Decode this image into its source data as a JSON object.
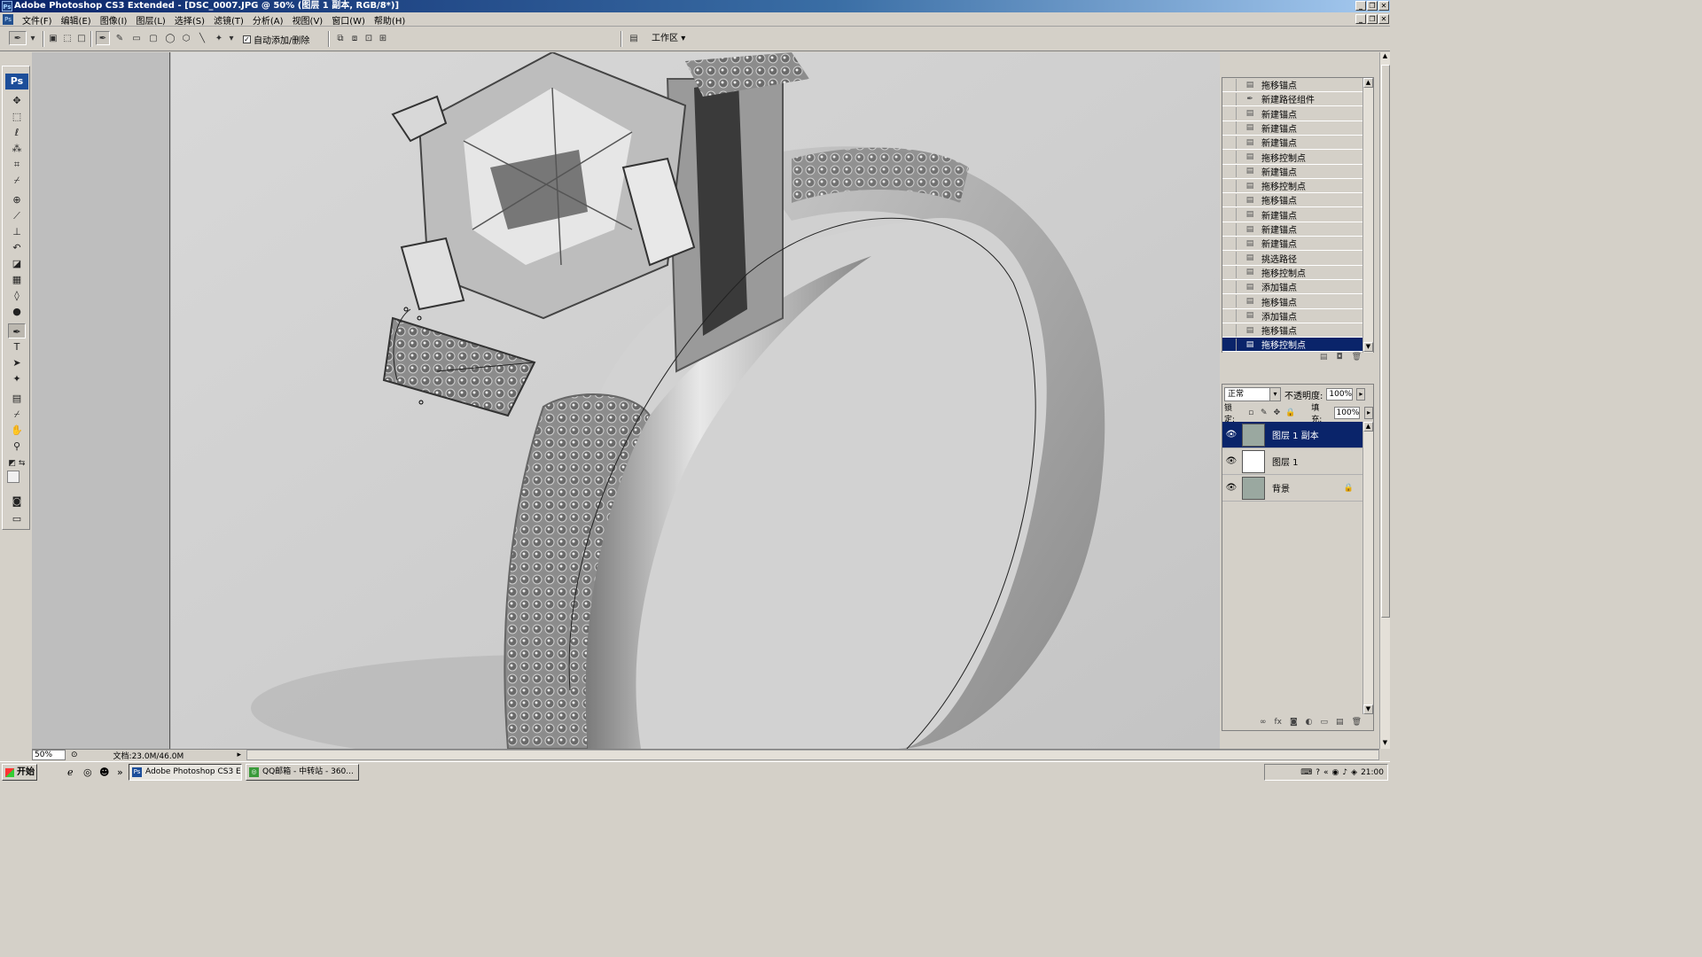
{
  "window": {
    "title": "Adobe Photoshop CS3 Extended - [DSC_0007.JPG @ 50% (图层 1 副本, RGB/8*)]",
    "app_icon": "Ps"
  },
  "menu": [
    "文件(F)",
    "编辑(E)",
    "图像(I)",
    "图层(L)",
    "选择(S)",
    "滤镜(T)",
    "分析(A)",
    "视图(V)",
    "窗口(W)",
    "帮助(H)"
  ],
  "options_bar": {
    "auto_add_delete_label": "自动添加/删除",
    "auto_add_delete_checked": true,
    "workspace_label": "工作区"
  },
  "toolbox": {
    "logo": "Ps",
    "selected_tool": "pen-tool"
  },
  "history": {
    "items": [
      {
        "label": "拖移锚点",
        "icon": "history-step-icon"
      },
      {
        "label": "新建路径组件",
        "icon": "pen-icon"
      },
      {
        "label": "新建锚点",
        "icon": "history-step-icon"
      },
      {
        "label": "新建锚点",
        "icon": "history-step-icon"
      },
      {
        "label": "新建锚点",
        "icon": "history-step-icon"
      },
      {
        "label": "拖移控制点",
        "icon": "history-step-icon"
      },
      {
        "label": "新建锚点",
        "icon": "history-step-icon"
      },
      {
        "label": "拖移控制点",
        "icon": "history-step-icon"
      },
      {
        "label": "拖移锚点",
        "icon": "history-step-icon"
      },
      {
        "label": "新建锚点",
        "icon": "history-step-icon"
      },
      {
        "label": "新建锚点",
        "icon": "history-step-icon"
      },
      {
        "label": "新建锚点",
        "icon": "history-step-icon"
      },
      {
        "label": "挑选路径",
        "icon": "history-step-icon"
      },
      {
        "label": "拖移控制点",
        "icon": "history-step-icon"
      },
      {
        "label": "添加锚点",
        "icon": "history-step-icon"
      },
      {
        "label": "拖移锚点",
        "icon": "history-step-icon"
      },
      {
        "label": "添加锚点",
        "icon": "history-step-icon"
      },
      {
        "label": "拖移锚点",
        "icon": "history-step-icon"
      },
      {
        "label": "拖移控制点",
        "icon": "history-step-icon"
      }
    ],
    "selected_index": 18
  },
  "layers_panel": {
    "blend_mode": "正常",
    "opacity_label": "不透明度:",
    "opacity_value": "100%",
    "lock_label": "锁定:",
    "fill_label": "填充:",
    "fill_value": "100%",
    "layers": [
      {
        "name": "图层 1 副本",
        "visible": true,
        "selected": true,
        "locked": false
      },
      {
        "name": "图层 1",
        "visible": true,
        "selected": false,
        "locked": false
      },
      {
        "name": "背景",
        "visible": true,
        "selected": false,
        "locked": true
      }
    ]
  },
  "status": {
    "zoom": "50%",
    "doc_info": "文档:23.0M/46.0M"
  },
  "taskbar": {
    "start_label": "开始",
    "tasks": [
      {
        "label": "Adobe Photoshop CS3 E...",
        "active": true,
        "icon": "photoshop-icon"
      },
      {
        "label": "QQ邮箱 - 中转站 - 360...",
        "active": false,
        "icon": "browser-icon"
      }
    ],
    "clock": "21:00"
  }
}
